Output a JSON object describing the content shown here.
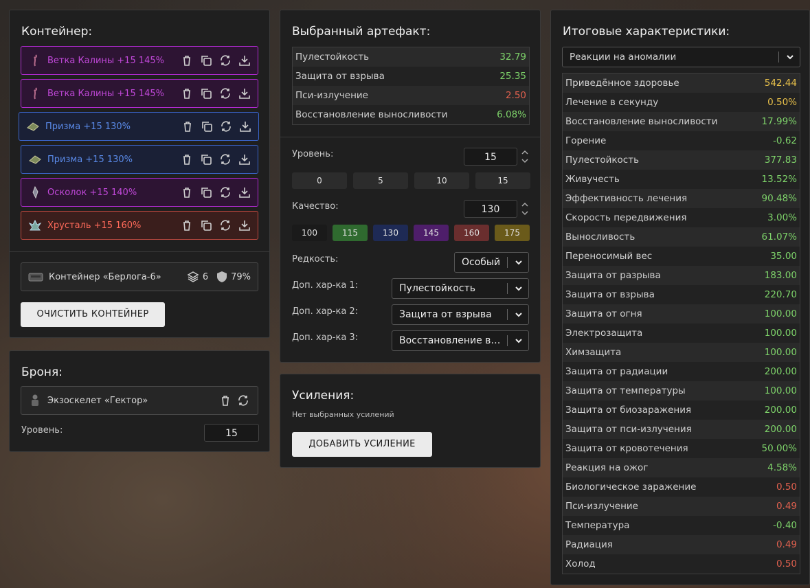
{
  "container": {
    "title": "Контейнер:",
    "artifacts": [
      {
        "name": "Ветка Калины +15 145%",
        "rarity": "purple",
        "icon": "branch-icon"
      },
      {
        "name": "Ветка Калины +15 145%",
        "rarity": "purple",
        "icon": "branch-icon"
      },
      {
        "name": "Призма +15 130%",
        "rarity": "blue",
        "icon": "prism-icon"
      },
      {
        "name": "Призма +15 130%",
        "rarity": "blue",
        "icon": "prism-icon"
      },
      {
        "name": "Осколок +15 140%",
        "rarity": "purple",
        "icon": "shard-icon"
      },
      {
        "name": "Хрусталь +15 160%",
        "rarity": "red",
        "icon": "crystal-icon"
      }
    ],
    "container_name": "Контейнер «Берлога-6»",
    "slots": "6",
    "protection": "79%",
    "clear_button": "ОЧИСТИТЬ КОНТЕЙНЕР"
  },
  "armor": {
    "title": "Броня:",
    "name": "Экзоскелет «Гектор»",
    "level_label": "Уровень:",
    "level_value": "15"
  },
  "selected": {
    "title": "Выбранный артефакт:",
    "stats": [
      {
        "label": "Пулестойкость",
        "value": "32.79",
        "color": "green"
      },
      {
        "label": "Защита от взрыва",
        "value": "25.35",
        "color": "green"
      },
      {
        "label": "Пси-излучение",
        "value": "2.50",
        "color": "red"
      },
      {
        "label": "Восстановление выносливости",
        "value": "6.08%",
        "color": "green"
      }
    ],
    "level_label": "Уровень:",
    "level_value": "15",
    "level_presets": [
      "0",
      "5",
      "10",
      "15"
    ],
    "quality_label": "Качество:",
    "quality_value": "130",
    "quality_presets": [
      "100",
      "115",
      "130",
      "145",
      "160",
      "175"
    ],
    "rarity_label": "Редкость:",
    "rarity_value": "Особый",
    "extra1_label": "Доп. хар-ка 1:",
    "extra1_value": "Пулестойкость",
    "extra2_label": "Доп. хар-ка 2:",
    "extra2_value": "Защита от взрыва",
    "extra3_label": "Доп. хар-ка 3:",
    "extra3_value": "Восстановление выносливости"
  },
  "boosts": {
    "title": "Усиления:",
    "empty_text": "Нет выбранных усилений",
    "add_button": "ДОБАВИТЬ УСИЛЕНИЕ"
  },
  "totals": {
    "title": "Итоговые характеристики:",
    "filter": "Реакции на аномалии",
    "rows": [
      {
        "label": "Приведённое здоровье",
        "value": "542.44",
        "color": "yellow"
      },
      {
        "label": "Лечение в секунду",
        "value": "0.50%",
        "color": "yellow"
      },
      {
        "label": "Восстановление выносливости",
        "value": "17.99%",
        "color": "green"
      },
      {
        "label": "Горение",
        "value": "-0.62",
        "color": "green"
      },
      {
        "label": "Пулестойкость",
        "value": "377.83",
        "color": "green"
      },
      {
        "label": "Живучесть",
        "value": "13.52%",
        "color": "green"
      },
      {
        "label": "Эффективность лечения",
        "value": "90.48%",
        "color": "green"
      },
      {
        "label": "Скорость передвижения",
        "value": "3.00%",
        "color": "green"
      },
      {
        "label": "Выносливость",
        "value": "61.07%",
        "color": "green"
      },
      {
        "label": "Переносимый вес",
        "value": "35.00",
        "color": "green"
      },
      {
        "label": "Защита от разрыва",
        "value": "183.00",
        "color": "green"
      },
      {
        "label": "Защита от взрыва",
        "value": "220.70",
        "color": "green"
      },
      {
        "label": "Защита от огня",
        "value": "100.00",
        "color": "green"
      },
      {
        "label": "Электрозащита",
        "value": "100.00",
        "color": "green"
      },
      {
        "label": "Химзащита",
        "value": "100.00",
        "color": "green"
      },
      {
        "label": "Защита от радиации",
        "value": "200.00",
        "color": "green"
      },
      {
        "label": "Защита от температуры",
        "value": "100.00",
        "color": "green"
      },
      {
        "label": "Защита от биозаражения",
        "value": "200.00",
        "color": "green"
      },
      {
        "label": "Защита от пси-излучения",
        "value": "200.00",
        "color": "green"
      },
      {
        "label": "Защита от кровотечения",
        "value": "50.00%",
        "color": "green"
      },
      {
        "label": "Реакция на ожог",
        "value": "4.58%",
        "color": "green"
      },
      {
        "label": "Биологическое заражение",
        "value": "0.50",
        "color": "red"
      },
      {
        "label": "Пси-излучение",
        "value": "0.49",
        "color": "red"
      },
      {
        "label": "Температура",
        "value": "-0.40",
        "color": "green"
      },
      {
        "label": "Радиация",
        "value": "0.49",
        "color": "red"
      },
      {
        "label": "Холод",
        "value": "0.50",
        "color": "red"
      }
    ]
  },
  "colors": {
    "green": "#7ed36a",
    "red": "#e0604e",
    "yellow": "#e8c04a"
  }
}
